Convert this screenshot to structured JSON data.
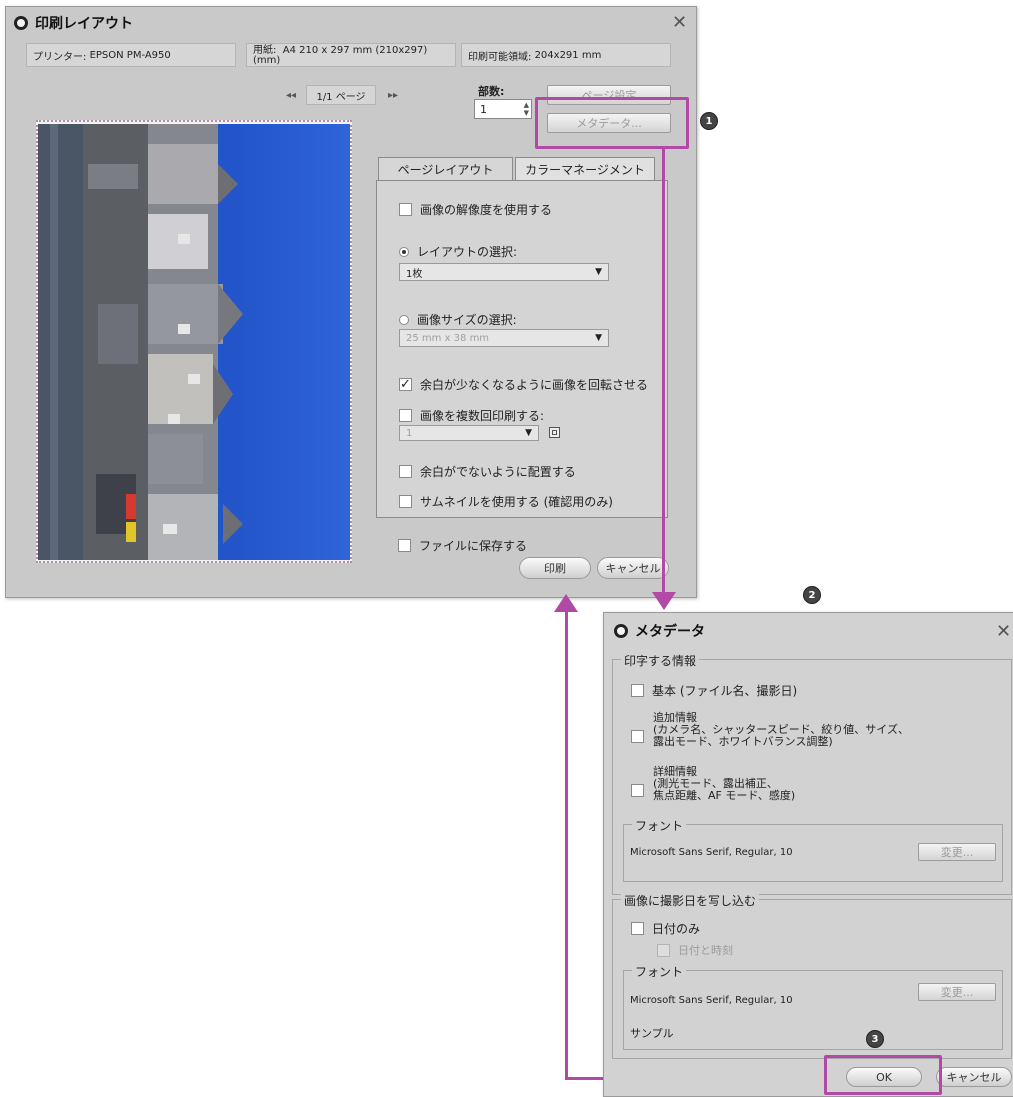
{
  "print_dialog": {
    "title": "印刷レイアウト",
    "printer_label": "プリンター:",
    "printer_value": "EPSON PM-A950",
    "paper_label": "用紙:",
    "paper_unit": "(mm)",
    "paper_value": "A4 210 x 297 mm (210x297)",
    "printable_label": "印刷可能領域:",
    "printable_value": "204x291 mm",
    "page_nav": {
      "first": "◂◂",
      "page_text": "1/1 ページ",
      "last": "▸▸"
    },
    "copies_label": "部数:",
    "copies_value": "1",
    "page_setup_button": "ページ設定",
    "metadata_button": "メタデータ...",
    "tabs": [
      "ページレイアウト",
      "カラーマネージメント"
    ],
    "use_resolution": "画像の解像度を使用する",
    "layout_select_label": "レイアウトの選択:",
    "layout_select_value": "1枚",
    "size_select_label": "画像サイズの選択:",
    "size_select_value": "25 mm x 38 mm",
    "rotate_label": "余白が少なくなるように画像を回転させる",
    "multi_print_label": "画像を複数回印刷する:",
    "multi_print_value": "1",
    "no_margin_label": "余白がでないように配置する",
    "thumbnail_label": "サムネイルを使用する (確認用のみ)",
    "save_file_label": "ファイルに保存する",
    "print_button": "印刷",
    "cancel_button": "キャンセル"
  },
  "metadata_dialog": {
    "title": "メタデータ",
    "print_info_group": "印字する情報",
    "basic_label": "基本 (ファイル名、撮影日)",
    "additional_title": "追加情報",
    "additional_line1": "(カメラ名、シャッタースピード、絞り値、サイズ、",
    "additional_line2": "露出モード、ホワイトバランス調整)",
    "detail_title": "詳細情報",
    "detail_line1": "(測光モード、露出補正、",
    "detail_line2": "焦点距離、AF モード、感度)",
    "font_group": "フォント",
    "font_value": "Microsoft Sans Serif, Regular, 10",
    "change_button": "変更...",
    "date_group": "画像に撮影日を写し込む",
    "date_only_label": "日付のみ",
    "date_time_label": "日付と時刻",
    "font_group2": "フォント",
    "font_value2": "Microsoft Sans Serif, Regular, 10",
    "change_button2": "変更...",
    "sample_label": "サンプル",
    "ok_button": "OK",
    "cancel_button": "キャンセル"
  },
  "badges": [
    "1",
    "2",
    "3"
  ],
  "colors": {
    "highlight": "#b04aa6",
    "dialog_bg": "#c9c9c9",
    "preview_sky": "#1f4fc8"
  }
}
